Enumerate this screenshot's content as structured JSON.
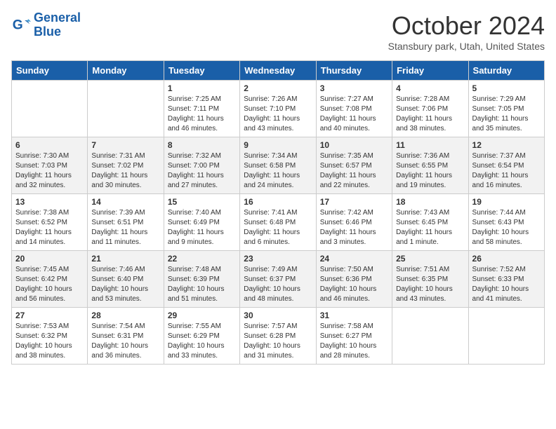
{
  "header": {
    "logo_line1": "General",
    "logo_line2": "Blue",
    "month": "October 2024",
    "location": "Stansbury park, Utah, United States"
  },
  "weekdays": [
    "Sunday",
    "Monday",
    "Tuesday",
    "Wednesday",
    "Thursday",
    "Friday",
    "Saturday"
  ],
  "weeks": [
    [
      {
        "day": "",
        "info": ""
      },
      {
        "day": "",
        "info": ""
      },
      {
        "day": "1",
        "info": "Sunrise: 7:25 AM\nSunset: 7:11 PM\nDaylight: 11 hours and 46 minutes."
      },
      {
        "day": "2",
        "info": "Sunrise: 7:26 AM\nSunset: 7:10 PM\nDaylight: 11 hours and 43 minutes."
      },
      {
        "day": "3",
        "info": "Sunrise: 7:27 AM\nSunset: 7:08 PM\nDaylight: 11 hours and 40 minutes."
      },
      {
        "day": "4",
        "info": "Sunrise: 7:28 AM\nSunset: 7:06 PM\nDaylight: 11 hours and 38 minutes."
      },
      {
        "day": "5",
        "info": "Sunrise: 7:29 AM\nSunset: 7:05 PM\nDaylight: 11 hours and 35 minutes."
      }
    ],
    [
      {
        "day": "6",
        "info": "Sunrise: 7:30 AM\nSunset: 7:03 PM\nDaylight: 11 hours and 32 minutes."
      },
      {
        "day": "7",
        "info": "Sunrise: 7:31 AM\nSunset: 7:02 PM\nDaylight: 11 hours and 30 minutes."
      },
      {
        "day": "8",
        "info": "Sunrise: 7:32 AM\nSunset: 7:00 PM\nDaylight: 11 hours and 27 minutes."
      },
      {
        "day": "9",
        "info": "Sunrise: 7:34 AM\nSunset: 6:58 PM\nDaylight: 11 hours and 24 minutes."
      },
      {
        "day": "10",
        "info": "Sunrise: 7:35 AM\nSunset: 6:57 PM\nDaylight: 11 hours and 22 minutes."
      },
      {
        "day": "11",
        "info": "Sunrise: 7:36 AM\nSunset: 6:55 PM\nDaylight: 11 hours and 19 minutes."
      },
      {
        "day": "12",
        "info": "Sunrise: 7:37 AM\nSunset: 6:54 PM\nDaylight: 11 hours and 16 minutes."
      }
    ],
    [
      {
        "day": "13",
        "info": "Sunrise: 7:38 AM\nSunset: 6:52 PM\nDaylight: 11 hours and 14 minutes."
      },
      {
        "day": "14",
        "info": "Sunrise: 7:39 AM\nSunset: 6:51 PM\nDaylight: 11 hours and 11 minutes."
      },
      {
        "day": "15",
        "info": "Sunrise: 7:40 AM\nSunset: 6:49 PM\nDaylight: 11 hours and 9 minutes."
      },
      {
        "day": "16",
        "info": "Sunrise: 7:41 AM\nSunset: 6:48 PM\nDaylight: 11 hours and 6 minutes."
      },
      {
        "day": "17",
        "info": "Sunrise: 7:42 AM\nSunset: 6:46 PM\nDaylight: 11 hours and 3 minutes."
      },
      {
        "day": "18",
        "info": "Sunrise: 7:43 AM\nSunset: 6:45 PM\nDaylight: 11 hours and 1 minute."
      },
      {
        "day": "19",
        "info": "Sunrise: 7:44 AM\nSunset: 6:43 PM\nDaylight: 10 hours and 58 minutes."
      }
    ],
    [
      {
        "day": "20",
        "info": "Sunrise: 7:45 AM\nSunset: 6:42 PM\nDaylight: 10 hours and 56 minutes."
      },
      {
        "day": "21",
        "info": "Sunrise: 7:46 AM\nSunset: 6:40 PM\nDaylight: 10 hours and 53 minutes."
      },
      {
        "day": "22",
        "info": "Sunrise: 7:48 AM\nSunset: 6:39 PM\nDaylight: 10 hours and 51 minutes."
      },
      {
        "day": "23",
        "info": "Sunrise: 7:49 AM\nSunset: 6:37 PM\nDaylight: 10 hours and 48 minutes."
      },
      {
        "day": "24",
        "info": "Sunrise: 7:50 AM\nSunset: 6:36 PM\nDaylight: 10 hours and 46 minutes."
      },
      {
        "day": "25",
        "info": "Sunrise: 7:51 AM\nSunset: 6:35 PM\nDaylight: 10 hours and 43 minutes."
      },
      {
        "day": "26",
        "info": "Sunrise: 7:52 AM\nSunset: 6:33 PM\nDaylight: 10 hours and 41 minutes."
      }
    ],
    [
      {
        "day": "27",
        "info": "Sunrise: 7:53 AM\nSunset: 6:32 PM\nDaylight: 10 hours and 38 minutes."
      },
      {
        "day": "28",
        "info": "Sunrise: 7:54 AM\nSunset: 6:31 PM\nDaylight: 10 hours and 36 minutes."
      },
      {
        "day": "29",
        "info": "Sunrise: 7:55 AM\nSunset: 6:29 PM\nDaylight: 10 hours and 33 minutes."
      },
      {
        "day": "30",
        "info": "Sunrise: 7:57 AM\nSunset: 6:28 PM\nDaylight: 10 hours and 31 minutes."
      },
      {
        "day": "31",
        "info": "Sunrise: 7:58 AM\nSunset: 6:27 PM\nDaylight: 10 hours and 28 minutes."
      },
      {
        "day": "",
        "info": ""
      },
      {
        "day": "",
        "info": ""
      }
    ]
  ]
}
